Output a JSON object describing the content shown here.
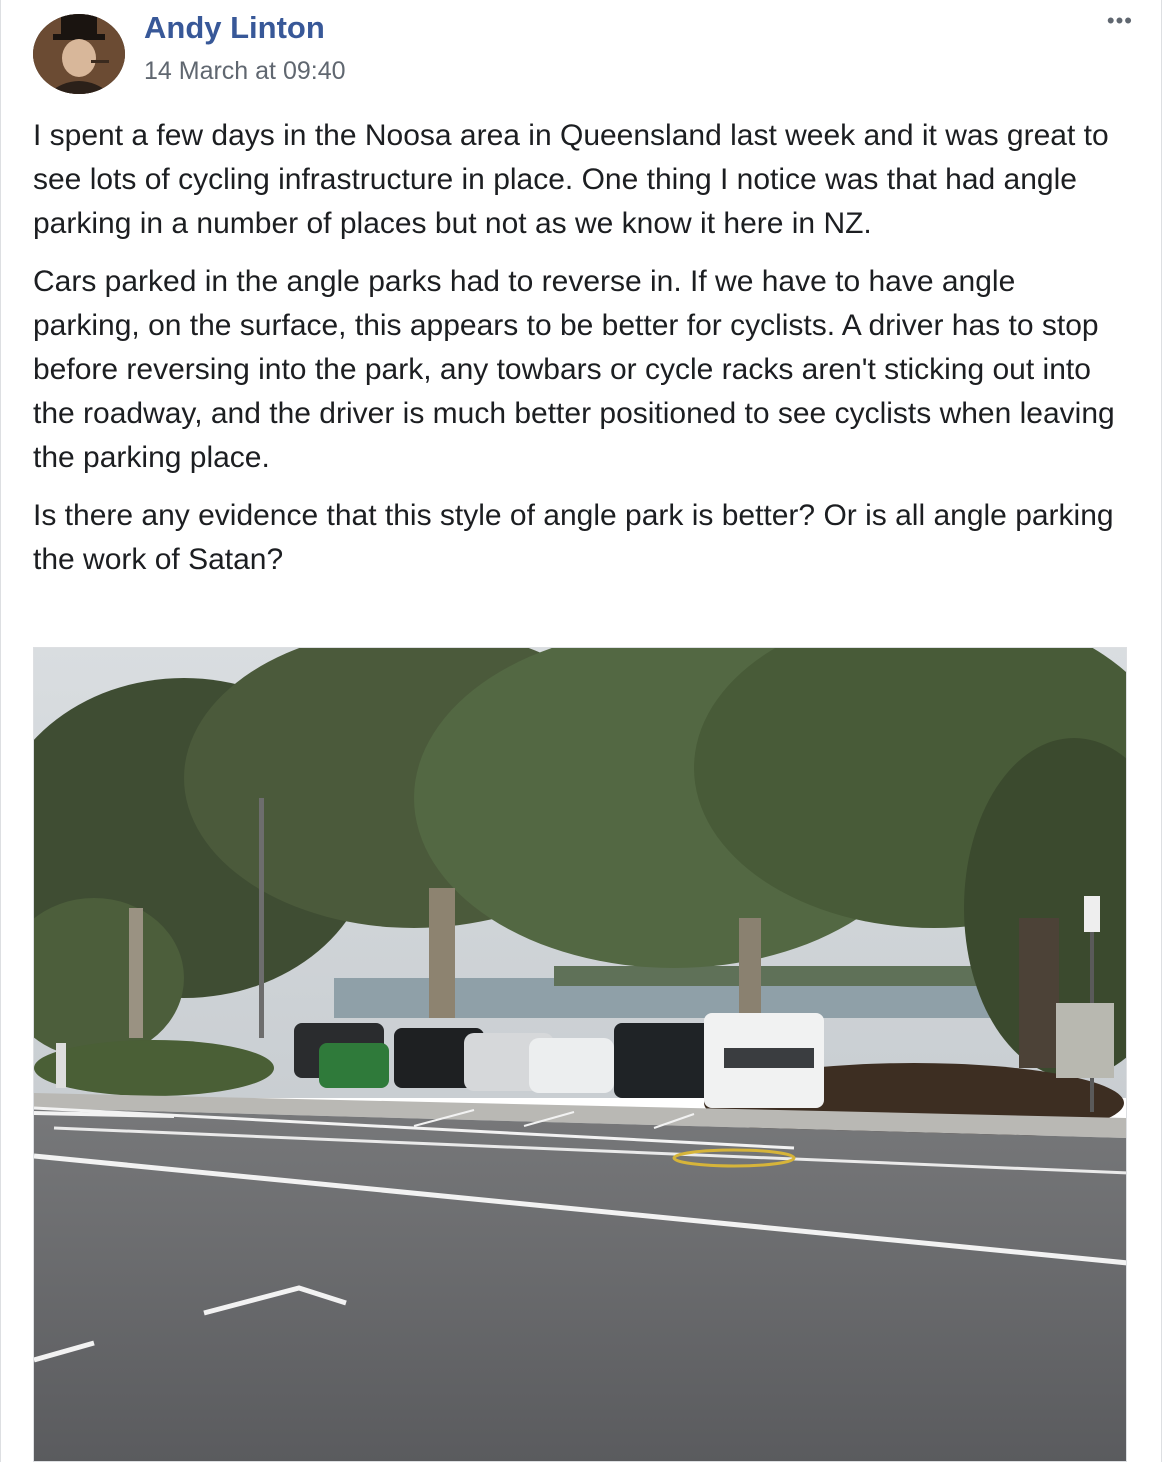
{
  "post": {
    "author": "Andy Linton",
    "timestamp": "14 March at 09:40",
    "more_label": "•••",
    "paragraphs": [
      "I spent a few days in the Noosa area in Queensland last week and it was great to see lots of cycling infrastructure in place. One thing I notice was that had angle parking in a number of places but not as we know it here in NZ.",
      "Cars parked in the angle parks had to reverse in. If we have to have angle parking, on the surface, this appears to be better for cyclists. A driver has to stop before reversing into the park, any towbars or cycle racks aren't sticking out into the roadway, and the driver is much better positioned to see cyclists when leaving the parking place.",
      "Is there any evidence that this style of angle park is better? Or is all angle parking the work of Satan?"
    ]
  },
  "colors": {
    "author": "#385898",
    "meta": "#606770",
    "text": "#1c1e21"
  },
  "icons": {
    "more": "ellipsis-icon"
  }
}
